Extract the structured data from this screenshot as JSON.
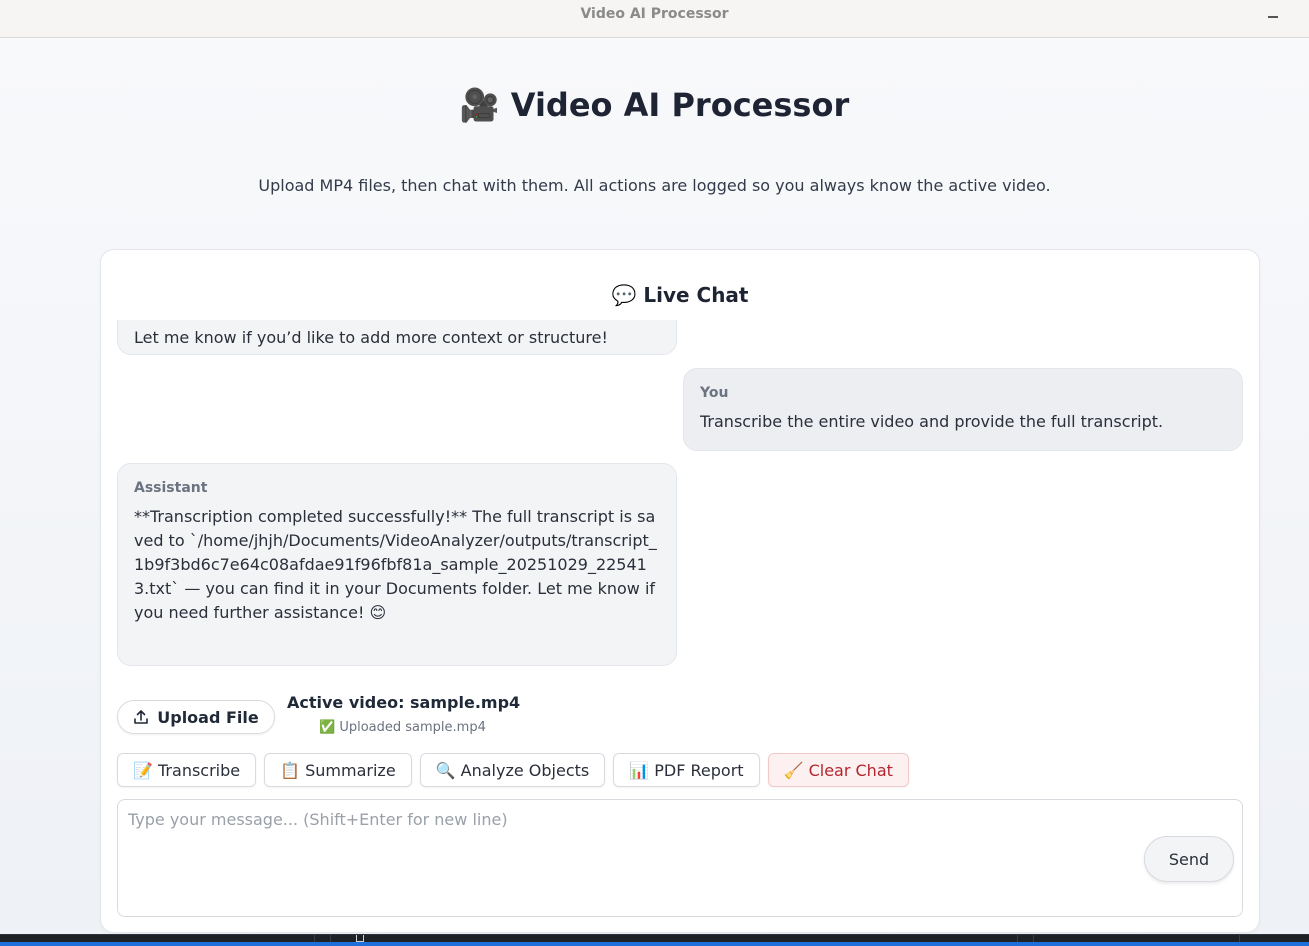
{
  "window": {
    "title": "Video AI Processor"
  },
  "header": {
    "title": "🎥 Video AI Processor",
    "subtitle": "Upload MP4 files, then chat with them. All actions are logged so you always know the active video."
  },
  "chat": {
    "heading": "💬 Live Chat",
    "messages": [
      {
        "role": "assistant",
        "text": "Let me know if you’d like to add more context or structure!"
      },
      {
        "role": "user",
        "sender": "You",
        "text": "Transcribe the entire video and provide the full transcript."
      },
      {
        "role": "assistant",
        "sender": "Assistant",
        "text": "**Transcription completed successfully!** The full transcript is saved to `/home/jhjh/Documents/VideoAnalyzer/outputs/transcript_1b9f3bd6c7e64c08afdae91f96fbf81a_sample_20251029_225413.txt` — you can find it in your Documents folder. Let me know if you need further assistance! 😊"
      }
    ]
  },
  "upload": {
    "button_label": "Upload File",
    "active_video": "Active video: sample.mp4",
    "status": "✅ Uploaded sample.mp4"
  },
  "actions": {
    "transcribe": "📝 Transcribe",
    "summarize": "📋 Summarize",
    "analyze": "🔍 Analyze Objects",
    "pdf": "📊 PDF Report",
    "clear": "🧹 Clear Chat"
  },
  "composer": {
    "placeholder": "Type your message... (Shift+Enter for new line)",
    "value": "",
    "send_label": "Send"
  }
}
